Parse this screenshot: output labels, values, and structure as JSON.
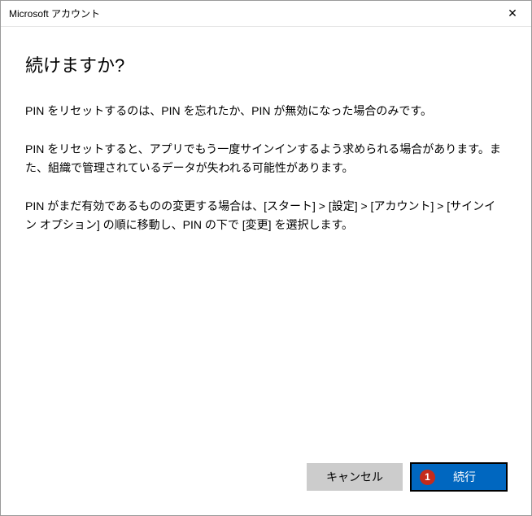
{
  "titlebar": {
    "title": "Microsoft アカウント"
  },
  "content": {
    "heading": "続けますか?",
    "paragraph1": "PIN をリセットするのは、PIN を忘れたか、PIN が無効になった場合のみです。",
    "paragraph2": "PIN をリセットすると、アプリでもう一度サインインするよう求められる場合があります。また、組織で管理されているデータが失われる可能性があります。",
    "paragraph3": "PIN がまだ有効であるものの変更する場合は、[スタート] > [設定] > [アカウント] > [サインイン オプション] の順に移動し、PIN の下で [変更] を選択します。"
  },
  "buttons": {
    "cancel": "キャンセル",
    "continue": "続行",
    "badge": "1"
  }
}
